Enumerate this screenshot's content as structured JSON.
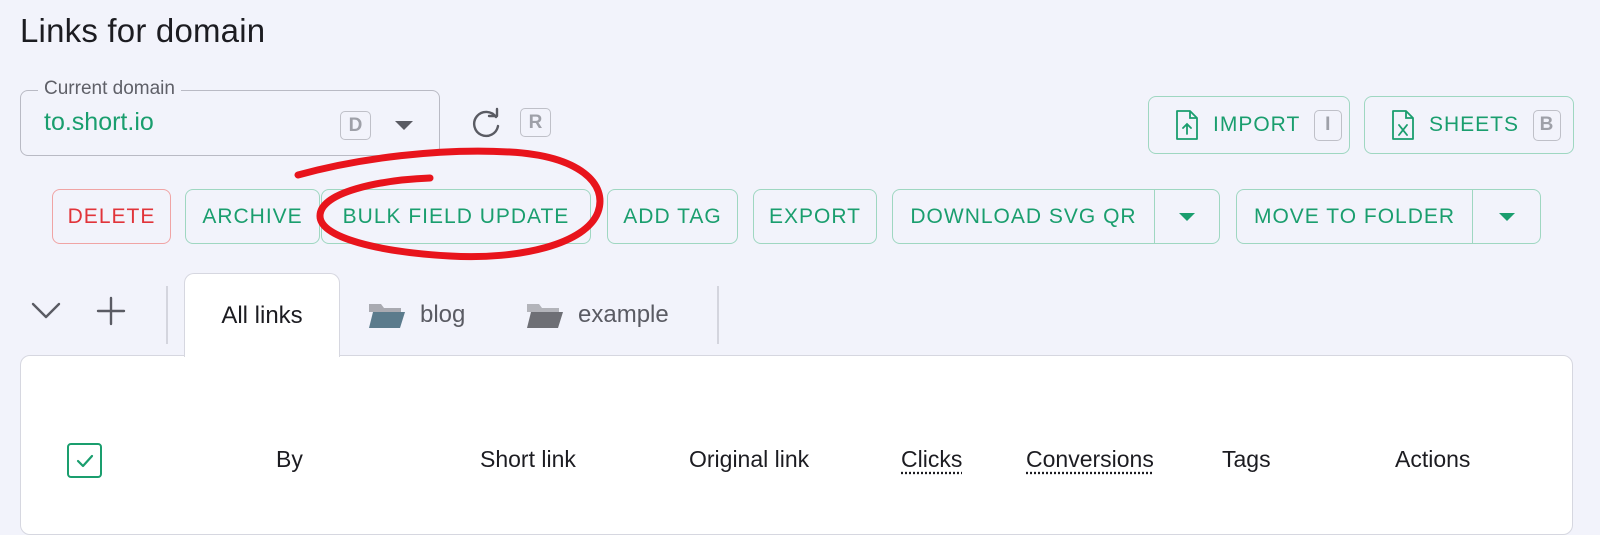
{
  "page": {
    "title": "Links for domain"
  },
  "domain_select": {
    "legend": "Current domain",
    "value": "to.short.io",
    "shortcut": "D"
  },
  "refresh": {
    "shortcut": "R"
  },
  "top_actions": {
    "import": {
      "label": "IMPORT",
      "shortcut": "I"
    },
    "sheets": {
      "label": "SHEETS",
      "shortcut": "B"
    }
  },
  "bulk_actions": {
    "delete": "DELETE",
    "archive": "ARCHIVE",
    "bulk_field_update": "BULK FIELD UPDATE",
    "add_tag": "ADD TAG",
    "export": "EXPORT",
    "download_svg_qr": "DOWNLOAD SVG QR",
    "move_to_folder": "MOVE TO FOLDER"
  },
  "tabs": [
    {
      "label": "All links",
      "active": true
    },
    {
      "label": "blog",
      "icon": "folder-icon",
      "icon_color": "#5b7b8c"
    },
    {
      "label": "example",
      "icon": "folder-icon",
      "icon_color": "#6e6f75"
    }
  ],
  "table": {
    "select_all_checked": true,
    "columns": [
      "By",
      "Short link",
      "Original link",
      "Clicks",
      "Conversions",
      "Tags",
      "Actions"
    ]
  },
  "colors": {
    "accent": "#1a9e6e",
    "danger": "#e1343a",
    "annotation": "#e8141c",
    "background": "#f2f3fb"
  }
}
